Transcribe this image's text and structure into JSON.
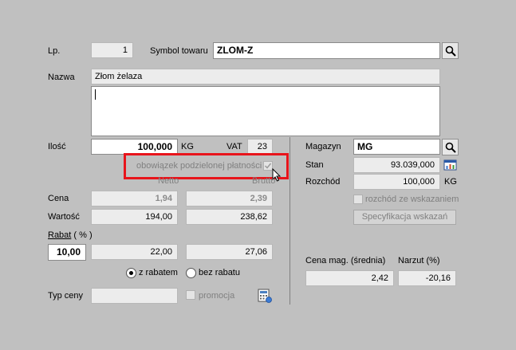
{
  "labels": {
    "lp": "Lp.",
    "symbol": "Symbol towaru",
    "nazwa": "Nazwa",
    "ilosc": "Ilość",
    "kg": "KG",
    "vat": "VAT",
    "obowiazek": "obowiązek podzielonej płatności",
    "netto": "Netto",
    "brutto": "Brutto",
    "cena": "Cena",
    "wartosc": "Wartość",
    "rabat": "Rabat",
    "rabat_unit": " ( % )",
    "z_rabatem": "z rabatem",
    "bez_rabatu": "bez rabatu",
    "typ_ceny": "Typ ceny",
    "promocja": "promocja",
    "magazyn": "Magazyn",
    "stan": "Stan",
    "rozchod": "Rozchód",
    "rozchod_kg": "KG",
    "rozchod_ze_wskazaniem": "rozchód ze wskazaniem",
    "specyfikacja": "Specyfikacja wskazań",
    "cena_mag": "Cena mag. (średnia)",
    "narzut": "Narzut (%)"
  },
  "values": {
    "lp": "1",
    "symbol": "ZLOM-Z",
    "nazwa": "Złom żelaza",
    "opis": "",
    "ilosc": "100,000",
    "vat": "23",
    "cena_netto": "1,94",
    "cena_brutto": "2,39",
    "wartosc_netto": "194,00",
    "wartosc_brutto": "238,62",
    "rabat": "10,00",
    "rabat_netto": "22,00",
    "rabat_brutto": "27,06",
    "typ_ceny": "",
    "magazyn": "MG",
    "stan": "93.039,000",
    "rozchod": "100,000",
    "cena_mag": "2,42",
    "narzut": "-20,16"
  },
  "state": {
    "z_rabatem_selected": true,
    "obowiazek_checked": true
  },
  "colors": {
    "background": "#c0c0c0",
    "highlight": "#e8141b"
  },
  "icons": {
    "search": "magnifier-icon",
    "stan": "chart-icon",
    "typ_ceny": "calculator-icon"
  }
}
